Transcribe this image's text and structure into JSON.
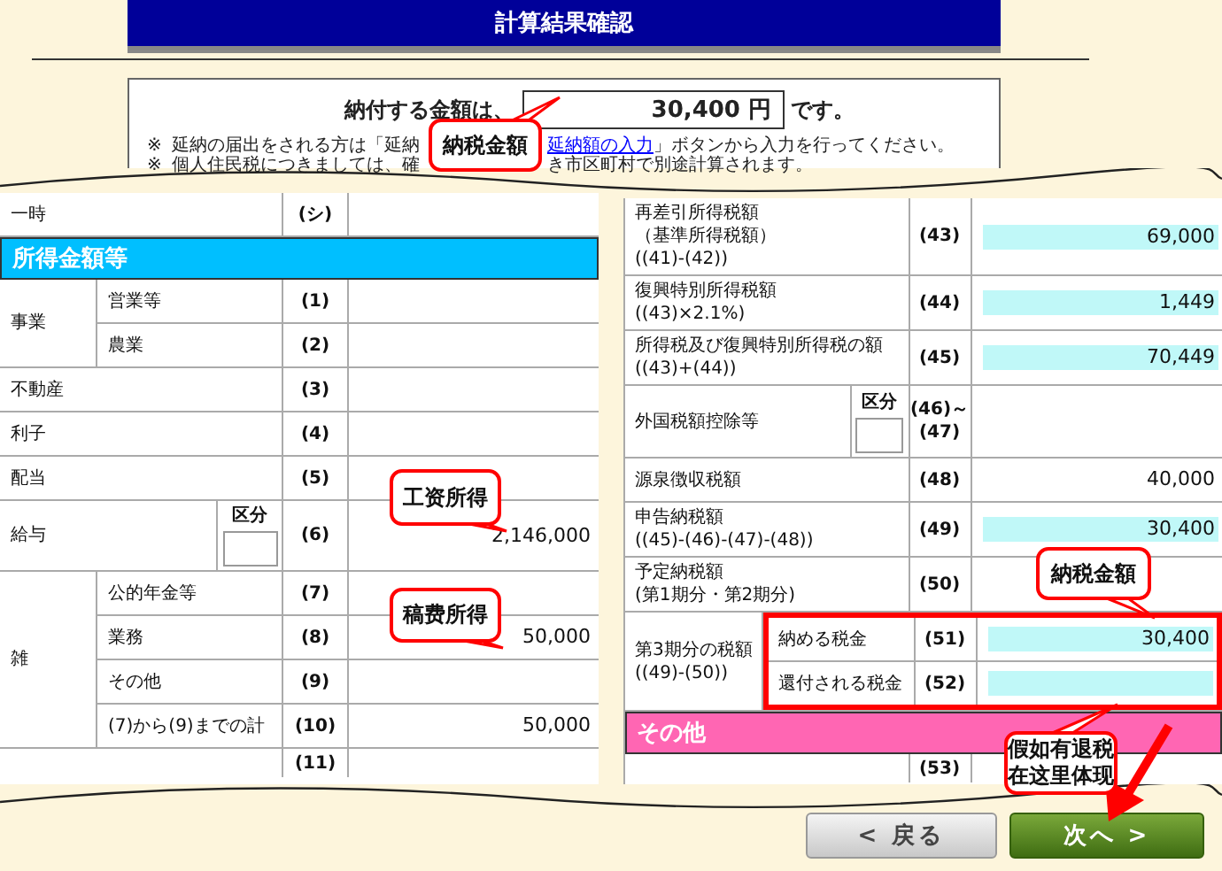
{
  "header": {
    "title": "計算結果確認"
  },
  "summary": {
    "lead": "納付する金額は、",
    "amount": "30,400",
    "unit": "円",
    "tail": "です。",
    "notes": [
      {
        "mark": "※",
        "start": "延納の届出をされる方は「延納",
        "end": [
          {
            "kind": "link",
            "text": "延納額の入力"
          },
          {
            "kind": "text",
            "text": "」ボタンから入力を行ってください。"
          }
        ]
      },
      {
        "mark": "※",
        "start": "個人住民税につきましては、確",
        "end": [
          {
            "kind": "text",
            "text": "き市区町村で別途計算されます。"
          }
        ]
      }
    ]
  },
  "income_table": {
    "rows": [
      {
        "kind": "row",
        "label": [
          "一時"
        ],
        "number": [
          "(シ)"
        ]
      },
      {
        "kind": "section",
        "label": "所得金額等",
        "color": "#00bfff"
      },
      {
        "kind": "group",
        "label": [
          "事業"
        ],
        "framed": false,
        "children": [
          {
            "label": [
              "営業等"
            ],
            "number": [
              "(1)"
            ]
          },
          {
            "label": [
              "農業"
            ],
            "number": [
              "(2)"
            ]
          }
        ]
      },
      {
        "kind": "row",
        "label": [
          "不動産"
        ],
        "number": [
          "(3)"
        ]
      },
      {
        "kind": "row",
        "label": [
          "利子"
        ],
        "number": [
          "(4)"
        ]
      },
      {
        "kind": "row",
        "label": [
          "配当"
        ],
        "number": [
          "(5)"
        ]
      },
      {
        "kind": "kubun",
        "label": [
          "給与"
        ],
        "kubun_label": "区分",
        "number": [
          "(6)"
        ],
        "value": "2,146,000",
        "highlighted": false
      },
      {
        "kind": "group",
        "label": [
          "雑"
        ],
        "framed": false,
        "children": [
          {
            "label": [
              "公的年金等"
            ],
            "number": [
              "(7)"
            ]
          },
          {
            "label": [
              "業務"
            ],
            "number": [
              "(8)"
            ],
            "value": "50,000",
            "highlighted": false
          },
          {
            "label": [
              "その他"
            ],
            "number": [
              "(9)"
            ]
          },
          {
            "label": [
              "(7)から(9)までの計"
            ],
            "number": [
              "(10)"
            ],
            "value": "50,000",
            "highlighted": false
          }
        ]
      },
      {
        "kind": "partial",
        "number": [
          "(11)"
        ]
      }
    ]
  },
  "tax_table": {
    "rows": [
      {
        "kind": "row",
        "label": [
          "再差引所得税額",
          "（基準所得税額）",
          "((41)-(42))"
        ],
        "number": [
          "(43)"
        ],
        "value": "69,000",
        "highlighted": true
      },
      {
        "kind": "row",
        "label": [
          "復興特別所得税額",
          "((43)×2.1%)"
        ],
        "number": [
          "(44)"
        ],
        "value": "1,449",
        "highlighted": true
      },
      {
        "kind": "row",
        "label": [
          "所得税及び復興特別所得税の額",
          "((43)+(44))"
        ],
        "number": [
          "(45)"
        ],
        "value": "70,449",
        "highlighted": true
      },
      {
        "kind": "kubun",
        "label": [
          "外国税額控除等"
        ],
        "kubun_label": "区分",
        "number": [
          "(46)～",
          "(47)"
        ]
      },
      {
        "kind": "row",
        "label": [
          "源泉徴収税額"
        ],
        "number": [
          "(48)"
        ],
        "value": "40,000",
        "highlighted": false
      },
      {
        "kind": "row",
        "label": [
          "申告納税額",
          "((45)-(46)-(47)-(48))"
        ],
        "number": [
          "(49)"
        ],
        "value": "30,400",
        "highlighted": true
      },
      {
        "kind": "row",
        "label": [
          "予定納税額",
          "(第1期分・第2期分)"
        ],
        "number": [
          "(50)"
        ]
      },
      {
        "kind": "group",
        "label": [
          "第3期分の税額",
          "((49)-(50))"
        ],
        "framed": true,
        "children": [
          {
            "label": [
              "納める税金"
            ],
            "number": [
              "(51)"
            ],
            "value": "30,400",
            "highlighted": true
          },
          {
            "label": [
              "還付される税金"
            ],
            "number": [
              "(52)"
            ],
            "highlighted": true
          }
        ]
      },
      {
        "kind": "section",
        "label": "その他",
        "color": "#ff66b3"
      },
      {
        "kind": "partial",
        "number": [
          "(53)"
        ]
      }
    ]
  },
  "buttons": [
    {
      "kind": "back",
      "label": "< 戻る"
    },
    {
      "kind": "next",
      "label": "次へ >"
    }
  ],
  "annotations": [
    {
      "lines": [
        "納税金額"
      ]
    },
    {
      "lines": [
        "工资所得"
      ]
    },
    {
      "lines": [
        "稿费所得"
      ]
    },
    {
      "lines": [
        "納税金額"
      ]
    },
    {
      "lines": [
        "假如有退税",
        "在这里体现"
      ]
    }
  ]
}
